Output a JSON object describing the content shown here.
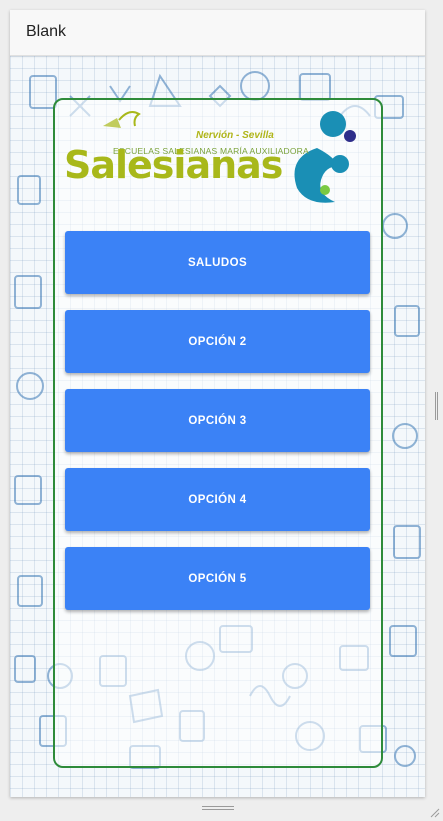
{
  "app": {
    "title": "Blank"
  },
  "logo": {
    "tagline": "Nervión - Sevilla",
    "subtitle": "ESCUELAS SALESIANAS MARÍA AUXILIADORA",
    "wordmark": "Salesianas"
  },
  "menu": {
    "buttons": [
      {
        "label": "SALUDOS"
      },
      {
        "label": "OPCIÓN 2"
      },
      {
        "label": "OPCIÓN 3"
      },
      {
        "label": "OPCIÓN 4"
      },
      {
        "label": "OPCIÓN 5"
      }
    ]
  },
  "colors": {
    "button": "#3b82f6",
    "card_border": "#2e8b3a",
    "logo_green": "#a8b81a",
    "logo_blue": "#1a8fb5"
  }
}
